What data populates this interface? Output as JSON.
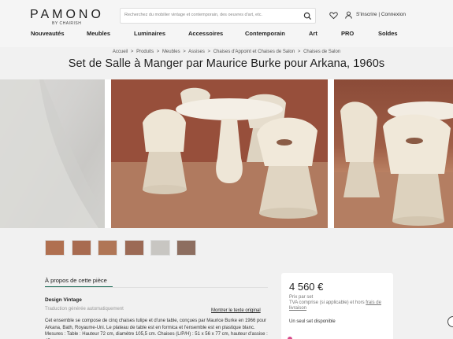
{
  "brand": {
    "logo_text": "PAMONO",
    "logo_sub": "BY CHAIRISH"
  },
  "search": {
    "placeholder": "Recherchez du mobilier vintage et contemporain, des oeuvres d'art, etc."
  },
  "auth": {
    "signup": "S'inscrire",
    "separator": "|",
    "login": "Connexion"
  },
  "nav": [
    "Nouveautés",
    "Meubles",
    "Luminaires",
    "Accessoires",
    "Contemporain",
    "Art",
    "PRO",
    "Soldes"
  ],
  "breadcrumb": [
    "Accueil",
    "Produits",
    "Meubles",
    "Assises",
    "Chaises d'Appoint et Chaises de Salon",
    "Chaises de Salon"
  ],
  "breadcrumb_sep": ">",
  "product": {
    "title": "Set de Salle à Manger par Maurice Burke pour Arkana, 1960s"
  },
  "about": {
    "tab_label": "À propos de cette pièce",
    "section_heading": "Design Vintage",
    "auto_translation": "Traduction générée automatiquement",
    "show_original": "Montrer le texte original",
    "description": "Cet ensemble se compose de cinq chaises tulipe et d'une table, conçues par Maurice Burke en 1966 pour Arkana, Bath, Royaume-Uni. Le plateau de table est en formica et l'ensemble est en plastique blanc. Mesures : Table : Hauteur 72 cm, diamètre 105,5 cm. Chaises (L/P/H) : 51 x 56 x 77 cm, hauteur d'assise : 45 cm."
  },
  "pricing": {
    "price": "4 560 €",
    "note_line1": "Prix par set",
    "note_line2": "TVA comprise (si applicable) et hors",
    "note_link": "frais de livraison",
    "availability": "Un seul set disponible"
  },
  "icons": {
    "search": "search-icon",
    "heart": "heart-icon",
    "user": "user-icon",
    "chat": "chat-icon"
  },
  "colors": {
    "accent": "#1a6b55",
    "background": "#f1f1f1",
    "pink": "#d64a8c"
  }
}
